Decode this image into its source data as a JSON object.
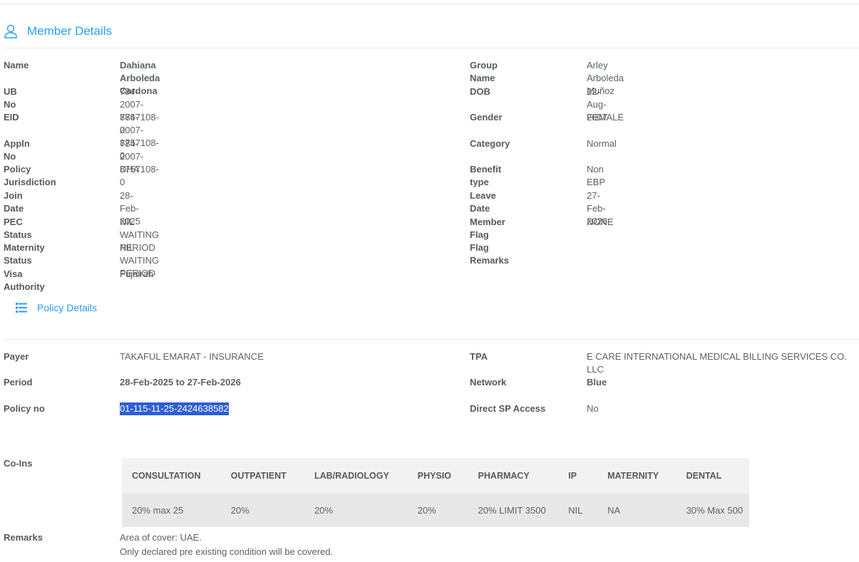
{
  "member": {
    "title": "Member Details",
    "left": [
      {
        "label": "Name",
        "value": "Dahiana Arboleda Cardona",
        "bold": true
      },
      {
        "label": "UB No",
        "value": "784-2007-8757108-0"
      },
      {
        "label": "EID",
        "value": "784-2007-8757108-0"
      },
      {
        "label": "Appln No",
        "value": "784-2007-8757108-0"
      },
      {
        "label": "Policy Jurisdiction",
        "value": "DHA"
      },
      {
        "label": "Join Date",
        "value": "28-Feb-2025"
      },
      {
        "label": "PEC Status",
        "value": "NIL WAITING PERIOD"
      },
      {
        "label": "Maternity Status",
        "value": "NIL WAITING PERIOD"
      },
      {
        "label": "Visa Authority",
        "value": "Fujairah"
      }
    ],
    "right": [
      {
        "label": "Group Name",
        "value": "Arley Arboleda Muñoz"
      },
      {
        "label": "DOB",
        "value": "22-Aug-2007"
      },
      {
        "label": "Gender",
        "value": "FEMALE"
      },
      {
        "label": "Category",
        "value": "Normal"
      },
      {
        "label": "Benefit type",
        "value": "Non EBP"
      },
      {
        "label": "Leave Date",
        "value": "27-Feb-2026"
      },
      {
        "label": "Member Flag",
        "value": "NONE"
      },
      {
        "label": "Flag Remarks",
        "value": ""
      }
    ]
  },
  "policy": {
    "title": "Policy Details",
    "payer_label": "Payer",
    "payer": "TAKAFUL EMARAT - INSURANCE",
    "tpa_label": "TPA",
    "tpa": "E CARE INTERNATIONAL MEDICAL BILLING SERVICES CO. LLC",
    "period_label": "Period",
    "period": "28-Feb-2025 to 27-Feb-2026",
    "network_label": "Network",
    "network": "Blue",
    "policy_no_label": "Policy no",
    "policy_no": "01-115-11-25-2424638582",
    "direct_label": "Direct SP Access",
    "direct": "No",
    "coins_label": "Co-Ins",
    "coins_headers": [
      "CONSULTATION",
      "OUTPATIENT",
      "LAB/RADIOLOGY",
      "PHYSIO",
      "PHARMACY",
      "IP",
      "MATERNITY",
      "DENTAL"
    ],
    "coins_values": [
      "20% max 25",
      "20%",
      "20%",
      "20%",
      "20% LIMIT 3500",
      "NIL",
      "NA",
      "30% Max 500"
    ],
    "remarks_label": "Remarks",
    "remarks": [
      "Area of cover: UAE.",
      "Only declared pre existing condition will be covered."
    ]
  }
}
